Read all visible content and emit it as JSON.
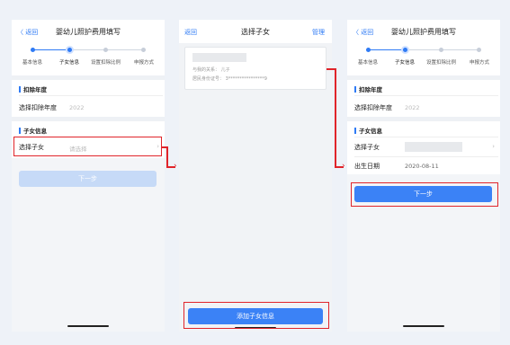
{
  "panel1": {
    "nav": {
      "back": "〈 返回",
      "title": "婴幼儿照护费用填写"
    },
    "steps": [
      "基本信息",
      "子女信息",
      "设置扣除比例",
      "申报方式"
    ],
    "section_year": "扣除年度",
    "year_label": "选择扣除年度",
    "year_value": "2022",
    "section_child": "子女信息",
    "child_label": "选择子女",
    "child_placeholder": "请选择",
    "next_button": "下一步"
  },
  "panel2": {
    "nav": {
      "back": "返回",
      "title": "选择子女",
      "manage": "管理"
    },
    "card": {
      "relation": "与我的关系：  儿子",
      "id": "居民身份证号：  3****************9"
    },
    "add_button": "添加子女信息"
  },
  "panel3": {
    "nav": {
      "back": "〈 返回",
      "title": "婴幼儿照护费用填写"
    },
    "steps": [
      "基本信息",
      "子女信息",
      "设置扣除比例",
      "申报方式"
    ],
    "section_year": "扣除年度",
    "year_label": "选择扣除年度",
    "year_value": "2022",
    "section_child": "子女信息",
    "child_label": "选择子女",
    "birth_label": "出生日期",
    "birth_value": "2020-08-11",
    "next_button": "下一步"
  },
  "colors": {
    "accent": "#2f7bf5",
    "highlight": "#e0242a",
    "background": "#eef2f8"
  },
  "icons": [
    "chevron-left-icon",
    "chevron-right-icon",
    "arrow-right-icon"
  ]
}
